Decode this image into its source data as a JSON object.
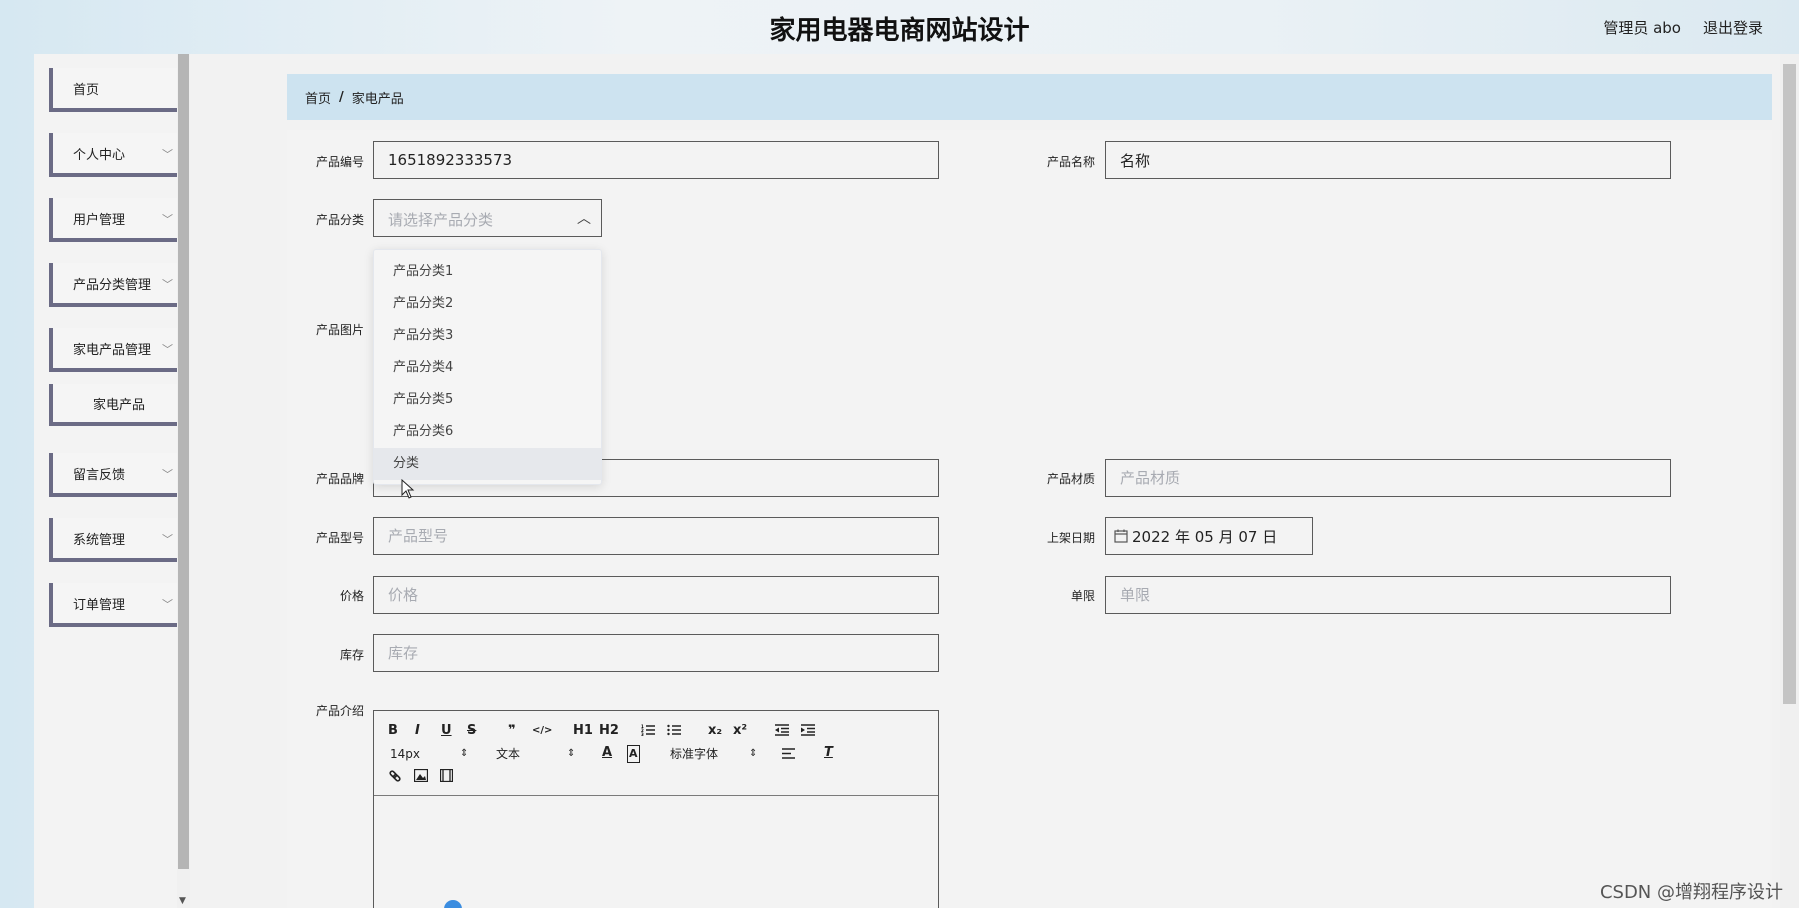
{
  "header": {
    "site_title": "家用电器电商网站设计",
    "user_label": "管理员 abo",
    "logout_label": "退出登录"
  },
  "sidebar": {
    "items": [
      {
        "label": "首页",
        "has_arrow": false
      },
      {
        "label": "个人中心",
        "has_arrow": true
      },
      {
        "label": "用户管理",
        "has_arrow": true
      },
      {
        "label": "产品分类管理",
        "has_arrow": true
      },
      {
        "label": "家电产品管理",
        "has_arrow": true
      },
      {
        "label": "留言反馈",
        "has_arrow": true
      },
      {
        "label": "系统管理",
        "has_arrow": true
      },
      {
        "label": "订单管理",
        "has_arrow": true
      }
    ],
    "submenu_label": "家电产品"
  },
  "breadcrumb": {
    "home": "首页",
    "separator": "/",
    "current": "家电产品"
  },
  "form": {
    "product_code": {
      "label": "产品编号",
      "value": "1651892333573"
    },
    "product_name": {
      "label": "产品名称",
      "value": "名称"
    },
    "product_category": {
      "label": "产品分类",
      "placeholder": "请选择产品分类",
      "options": [
        "产品分类1",
        "产品分类2",
        "产品分类3",
        "产品分类4",
        "产品分类5",
        "产品分类6",
        "分类"
      ],
      "hovered_option": "分类"
    },
    "product_image": {
      "label": "产品图片"
    },
    "product_brand": {
      "label": "产品品牌",
      "placeholder": ""
    },
    "product_material": {
      "label": "产品材质",
      "placeholder": "产品材质"
    },
    "product_model": {
      "label": "产品型号",
      "placeholder": "产品型号"
    },
    "listing_date": {
      "label": "上架日期",
      "value": "2022 年 05 月 07 日"
    },
    "price": {
      "label": "价格",
      "placeholder": "价格"
    },
    "limit": {
      "label": "单限",
      "placeholder": "单限"
    },
    "stock": {
      "label": "库存",
      "placeholder": "库存"
    },
    "description": {
      "label": "产品介绍"
    }
  },
  "editor": {
    "row1": [
      "B",
      "I",
      "U",
      "S",
      "❞",
      "</>",
      "H1",
      "H2",
      "ol",
      "ul",
      "x₂",
      "x²",
      "outdent",
      "indent"
    ],
    "font_size": "14px",
    "text_style": "文本",
    "font_family": "标准字体"
  },
  "watermark": "CSDN @增翔程序设计",
  "colors": {
    "breadcrumb_bg": "#cde3f0",
    "menu_border": "#6b6b85",
    "dropdown_hover": "#e6e8ec"
  }
}
